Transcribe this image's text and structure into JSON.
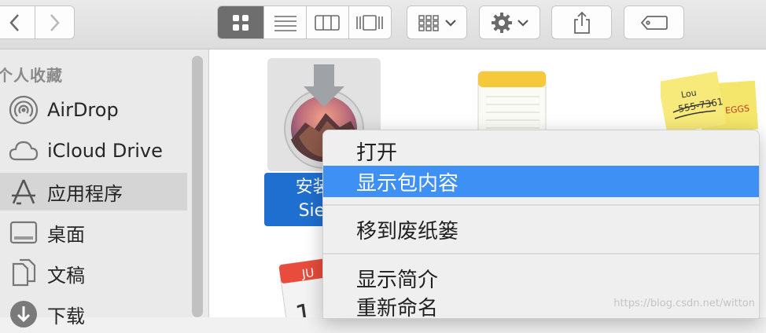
{
  "sidebar": {
    "section_title": "个人收藏",
    "items": [
      {
        "label": "AirDrop",
        "icon": "airdrop-icon"
      },
      {
        "label": "iCloud Drive",
        "icon": "cloud-icon"
      },
      {
        "label": "应用程序",
        "icon": "applications-icon",
        "selected": true
      },
      {
        "label": "桌面",
        "icon": "desktop-icon"
      },
      {
        "label": "文稿",
        "icon": "documents-icon"
      },
      {
        "label": "下载",
        "icon": "download-icon"
      }
    ]
  },
  "files": {
    "selected_label_line1": "安装 m",
    "selected_label_line2": "Sierra",
    "calendar_month": "JU",
    "sticky_text_1": "Lou",
    "sticky_text_2": "555-7361",
    "sticky_text_3": "EGGS"
  },
  "context_menu": {
    "items": [
      "打开",
      "显示包内容",
      "移到废纸篓",
      "显示简介",
      "重新命名"
    ],
    "highlighted": "显示包内容"
  },
  "colors": {
    "highlight": "#3f90f5",
    "selected_file_label": "#1f6fd0"
  },
  "watermark": "https://blog.csdn.net/witton"
}
